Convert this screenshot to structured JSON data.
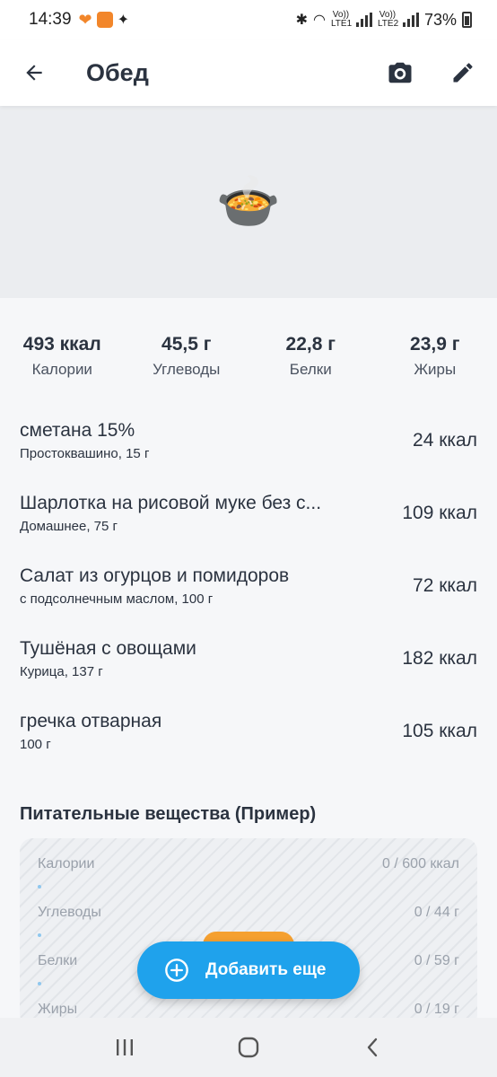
{
  "status_bar": {
    "time": "14:39",
    "sim1": "Vo)) LTE1",
    "sim2": "Vo)) LTE2",
    "battery": "73%"
  },
  "header": {
    "title": "Обед",
    "icons": [
      "back-arrow-icon",
      "camera-icon",
      "edit-pencil-icon"
    ]
  },
  "hero": {
    "emoji": "🍲"
  },
  "macros": [
    {
      "value": "493 ккал",
      "label": "Калории"
    },
    {
      "value": "45,5 г",
      "label": "Углеводы"
    },
    {
      "value": "22,8 г",
      "label": "Белки"
    },
    {
      "value": "23,9 г",
      "label": "Жиры"
    }
  ],
  "foods": [
    {
      "name": "сметана 15%",
      "detail": "Простоквашино, 15 г",
      "kcal": "24 ккал"
    },
    {
      "name": "Шарлотка на рисовой муке без с...",
      "detail": "Домашнее, 75 г",
      "kcal": "109 ккал"
    },
    {
      "name": "Салат из огурцов и помидоров",
      "detail": "с подсолнечным маслом, 100 г",
      "kcal": "72 ккал"
    },
    {
      "name": "Тушёная с овощами",
      "detail": "Курица, 137 г",
      "kcal": "182 ккал"
    },
    {
      "name": "гречка отварная",
      "detail": "100 г",
      "kcal": "105 ккал"
    }
  ],
  "nutrients": {
    "title": "Питательные вещества (Пример)",
    "rows": [
      {
        "label": "Калории",
        "value": "0 / 600 ккал",
        "progress": 0
      },
      {
        "label": "Углеводы",
        "value": "0 / 44 г",
        "progress": 0
      },
      {
        "label": "Белки",
        "value": "0 / 59 г",
        "progress": 0
      },
      {
        "label": "Жиры",
        "value": "0 / 19 г",
        "progress": 0
      }
    ]
  },
  "fab": {
    "label": "Добавить еще"
  },
  "colors": {
    "accent": "#1fa2ec",
    "orange": "#f5a030",
    "text": "#2b3340"
  }
}
